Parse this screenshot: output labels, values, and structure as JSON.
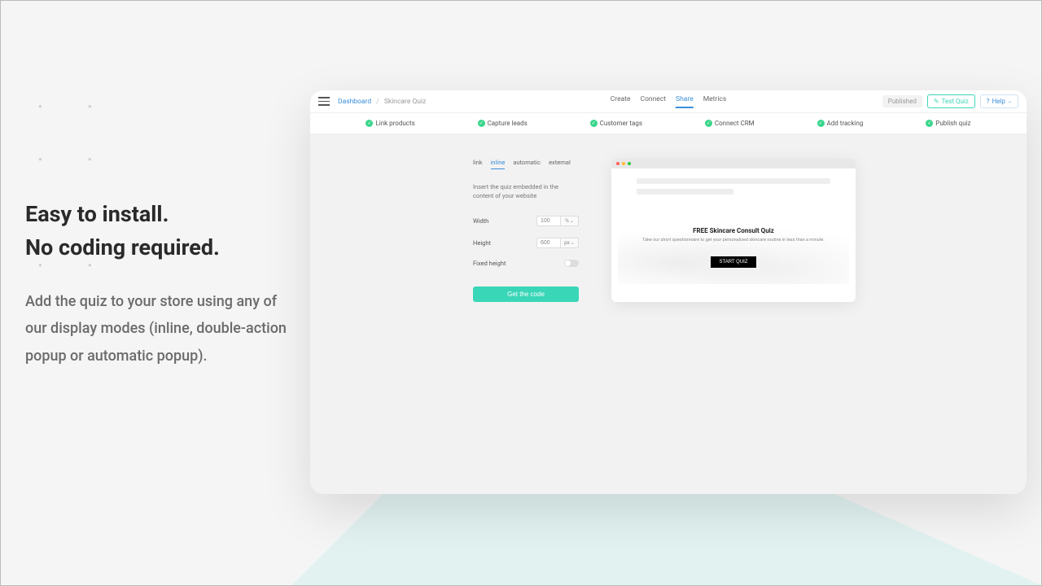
{
  "marketing": {
    "headline_1": "Easy to install.",
    "headline_2": "No coding required.",
    "subtext": "Add the quiz to your store using any of our display modes (inline, double-action popup or automatic popup)."
  },
  "breadcrumb": {
    "dashboard": "Dashboard",
    "current": "Skincare Quiz"
  },
  "main_tabs": {
    "create": "Create",
    "connect": "Connect",
    "share": "Share",
    "metrics": "Metrics"
  },
  "actions": {
    "published": "Published",
    "test_quiz": "Test Quiz",
    "help": "Help"
  },
  "steps": {
    "link_products": "Link products",
    "capture_leads": "Capture leads",
    "customer_tags": "Customer tags",
    "connect_crm": "Connect CRM",
    "add_tracking": "Add tracking",
    "publish_quiz": "Publish quiz"
  },
  "share": {
    "modes": {
      "link": "link",
      "inline": "inline",
      "automatic": "automatic",
      "external": "external"
    },
    "description": "Insert the quiz embedded in the content of your website",
    "width_label": "Width",
    "width_value": "100",
    "width_unit": "%",
    "height_label": "Height",
    "height_value": "600",
    "height_unit": "px",
    "fixed_height_label": "Fixed height",
    "get_code": "Get the code"
  },
  "preview": {
    "title": "FREE Skincare Consult Quiz",
    "subtitle": "Take our short questionnaire to get your personalized skincare routine in less than a minute.",
    "button": "START QUIZ"
  }
}
